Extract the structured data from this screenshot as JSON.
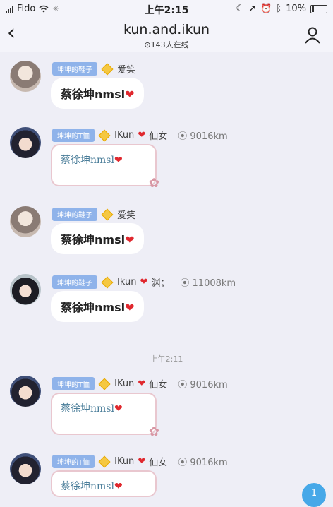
{
  "status_bar": {
    "carrier": "Fido",
    "time": "上午2:15",
    "battery": "10%"
  },
  "header": {
    "title": "kun.and.ikun",
    "online": "143人在线"
  },
  "messages": [
    {
      "badge": "坤坤的鞋子",
      "nickname": "爱笑",
      "text": "蔡徐坤nmsl",
      "type": "text",
      "avatar": "a1"
    },
    {
      "badge": "坤坤的T恤",
      "nickname": "IKun",
      "nickname_suffix": "仙女",
      "location": "9016km",
      "text": "蔡徐坤nmsl",
      "type": "card",
      "avatar": "a2"
    },
    {
      "badge": "坤坤的鞋子",
      "nickname": "爱笑",
      "text": "蔡徐坤nmsl",
      "type": "text",
      "avatar": "a1"
    },
    {
      "badge": "坤坤的鞋子",
      "nickname": "Ikun",
      "nickname_suffix": "渊；",
      "location": "11008km",
      "text": "蔡徐坤nmsl",
      "type": "text",
      "avatar": "a3"
    },
    {
      "badge": "坤坤的T恤",
      "nickname": "IKun",
      "nickname_suffix": "仙女",
      "location": "9016km",
      "text": "蔡徐坤nmsl",
      "type": "card",
      "avatar": "a2"
    },
    {
      "badge": "坤坤的T恤",
      "nickname": "IKun",
      "nickname_suffix": "仙女",
      "location": "9016km",
      "text": "蔡徐坤nmsl",
      "type": "card",
      "avatar": "a2"
    }
  ],
  "divider_time": "上午2:11",
  "unread_count": "1"
}
